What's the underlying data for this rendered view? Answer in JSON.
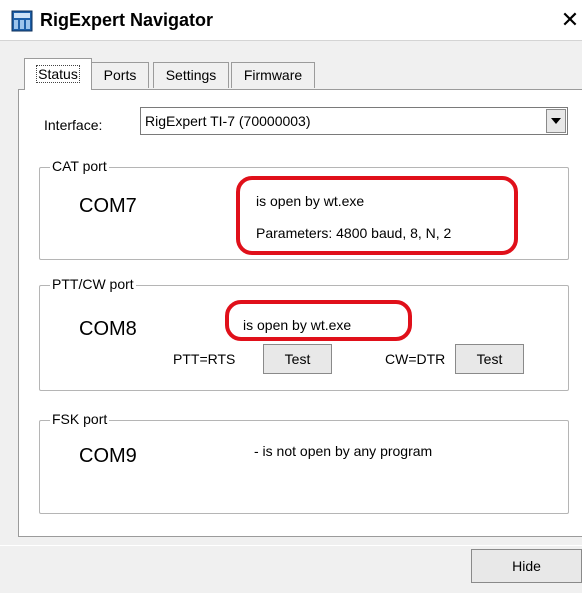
{
  "window": {
    "title": "RigExpert Navigator"
  },
  "tabs": [
    {
      "label": "Status"
    },
    {
      "label": "Ports"
    },
    {
      "label": "Settings"
    },
    {
      "label": "Firmware"
    }
  ],
  "status": {
    "interface_label": "Interface:",
    "interface_value": "RigExpert TI-7 (70000003)",
    "cat": {
      "legend": "CAT port",
      "com": "COM7",
      "state": "is open by wt.exe",
      "params": "Parameters: 4800 baud, 8, N, 2"
    },
    "ptt": {
      "legend": "PTT/CW port",
      "com": "COM8",
      "state": "is open by wt.exe",
      "ptt_label": "PTT=RTS",
      "cw_label": "CW=DTR",
      "test_label": "Test"
    },
    "fsk": {
      "legend": "FSK port",
      "com": "COM9",
      "state": "- is not open by any program"
    }
  },
  "footer": {
    "hide_label": "Hide"
  },
  "colors": {
    "highlight": "#e0101a",
    "panel": "#ffffff",
    "window_bg": "#f0f0f0"
  }
}
